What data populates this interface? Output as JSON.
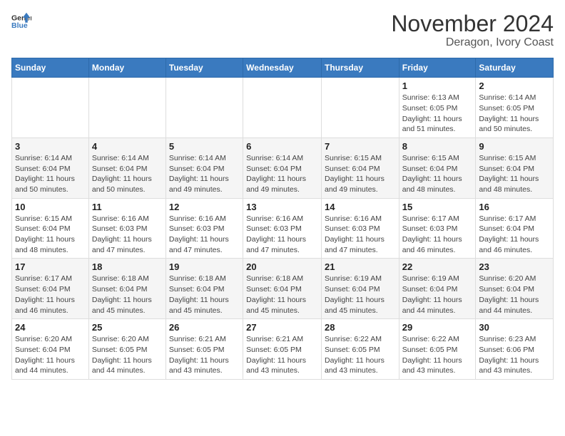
{
  "logo": {
    "general": "General",
    "blue": "Blue"
  },
  "title": "November 2024",
  "subtitle": "Deragon, Ivory Coast",
  "days_header": [
    "Sunday",
    "Monday",
    "Tuesday",
    "Wednesday",
    "Thursday",
    "Friday",
    "Saturday"
  ],
  "weeks": [
    [
      {
        "day": "",
        "detail": ""
      },
      {
        "day": "",
        "detail": ""
      },
      {
        "day": "",
        "detail": ""
      },
      {
        "day": "",
        "detail": ""
      },
      {
        "day": "",
        "detail": ""
      },
      {
        "day": "1",
        "detail": "Sunrise: 6:13 AM\nSunset: 6:05 PM\nDaylight: 11 hours and 51 minutes."
      },
      {
        "day": "2",
        "detail": "Sunrise: 6:14 AM\nSunset: 6:05 PM\nDaylight: 11 hours and 50 minutes."
      }
    ],
    [
      {
        "day": "3",
        "detail": "Sunrise: 6:14 AM\nSunset: 6:04 PM\nDaylight: 11 hours and 50 minutes."
      },
      {
        "day": "4",
        "detail": "Sunrise: 6:14 AM\nSunset: 6:04 PM\nDaylight: 11 hours and 50 minutes."
      },
      {
        "day": "5",
        "detail": "Sunrise: 6:14 AM\nSunset: 6:04 PM\nDaylight: 11 hours and 49 minutes."
      },
      {
        "day": "6",
        "detail": "Sunrise: 6:14 AM\nSunset: 6:04 PM\nDaylight: 11 hours and 49 minutes."
      },
      {
        "day": "7",
        "detail": "Sunrise: 6:15 AM\nSunset: 6:04 PM\nDaylight: 11 hours and 49 minutes."
      },
      {
        "day": "8",
        "detail": "Sunrise: 6:15 AM\nSunset: 6:04 PM\nDaylight: 11 hours and 48 minutes."
      },
      {
        "day": "9",
        "detail": "Sunrise: 6:15 AM\nSunset: 6:04 PM\nDaylight: 11 hours and 48 minutes."
      }
    ],
    [
      {
        "day": "10",
        "detail": "Sunrise: 6:15 AM\nSunset: 6:04 PM\nDaylight: 11 hours and 48 minutes."
      },
      {
        "day": "11",
        "detail": "Sunrise: 6:16 AM\nSunset: 6:03 PM\nDaylight: 11 hours and 47 minutes."
      },
      {
        "day": "12",
        "detail": "Sunrise: 6:16 AM\nSunset: 6:03 PM\nDaylight: 11 hours and 47 minutes."
      },
      {
        "day": "13",
        "detail": "Sunrise: 6:16 AM\nSunset: 6:03 PM\nDaylight: 11 hours and 47 minutes."
      },
      {
        "day": "14",
        "detail": "Sunrise: 6:16 AM\nSunset: 6:03 PM\nDaylight: 11 hours and 47 minutes."
      },
      {
        "day": "15",
        "detail": "Sunrise: 6:17 AM\nSunset: 6:03 PM\nDaylight: 11 hours and 46 minutes."
      },
      {
        "day": "16",
        "detail": "Sunrise: 6:17 AM\nSunset: 6:04 PM\nDaylight: 11 hours and 46 minutes."
      }
    ],
    [
      {
        "day": "17",
        "detail": "Sunrise: 6:17 AM\nSunset: 6:04 PM\nDaylight: 11 hours and 46 minutes."
      },
      {
        "day": "18",
        "detail": "Sunrise: 6:18 AM\nSunset: 6:04 PM\nDaylight: 11 hours and 45 minutes."
      },
      {
        "day": "19",
        "detail": "Sunrise: 6:18 AM\nSunset: 6:04 PM\nDaylight: 11 hours and 45 minutes."
      },
      {
        "day": "20",
        "detail": "Sunrise: 6:18 AM\nSunset: 6:04 PM\nDaylight: 11 hours and 45 minutes."
      },
      {
        "day": "21",
        "detail": "Sunrise: 6:19 AM\nSunset: 6:04 PM\nDaylight: 11 hours and 45 minutes."
      },
      {
        "day": "22",
        "detail": "Sunrise: 6:19 AM\nSunset: 6:04 PM\nDaylight: 11 hours and 44 minutes."
      },
      {
        "day": "23",
        "detail": "Sunrise: 6:20 AM\nSunset: 6:04 PM\nDaylight: 11 hours and 44 minutes."
      }
    ],
    [
      {
        "day": "24",
        "detail": "Sunrise: 6:20 AM\nSunset: 6:04 PM\nDaylight: 11 hours and 44 minutes."
      },
      {
        "day": "25",
        "detail": "Sunrise: 6:20 AM\nSunset: 6:05 PM\nDaylight: 11 hours and 44 minutes."
      },
      {
        "day": "26",
        "detail": "Sunrise: 6:21 AM\nSunset: 6:05 PM\nDaylight: 11 hours and 43 minutes."
      },
      {
        "day": "27",
        "detail": "Sunrise: 6:21 AM\nSunset: 6:05 PM\nDaylight: 11 hours and 43 minutes."
      },
      {
        "day": "28",
        "detail": "Sunrise: 6:22 AM\nSunset: 6:05 PM\nDaylight: 11 hours and 43 minutes."
      },
      {
        "day": "29",
        "detail": "Sunrise: 6:22 AM\nSunset: 6:05 PM\nDaylight: 11 hours and 43 minutes."
      },
      {
        "day": "30",
        "detail": "Sunrise: 6:23 AM\nSunset: 6:06 PM\nDaylight: 11 hours and 43 minutes."
      }
    ]
  ]
}
